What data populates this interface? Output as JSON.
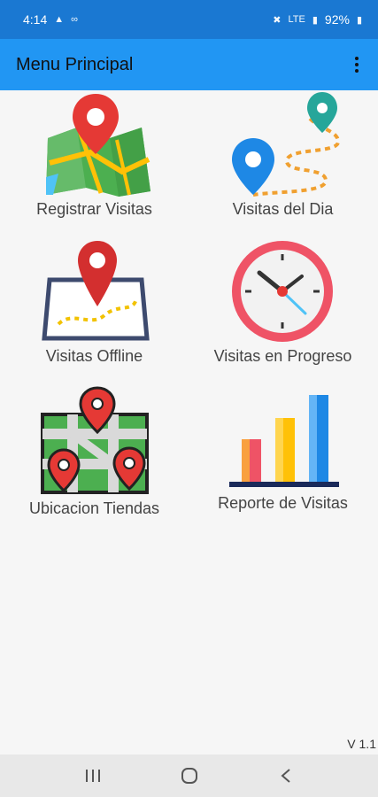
{
  "status_bar": {
    "time": "4:14",
    "battery": "92%",
    "signal_label": "LTE"
  },
  "app_bar": {
    "title": "Menu Principal",
    "overflow_icon": "more-vertical-icon"
  },
  "menu": [
    {
      "label": "Registrar Visitas",
      "icon": "map-pin-icon"
    },
    {
      "label": "Visitas del Dia",
      "icon": "route-icon"
    },
    {
      "label": "Visitas Offline",
      "icon": "offline-map-icon"
    },
    {
      "label": "Visitas en Progreso",
      "icon": "clock-icon"
    },
    {
      "label": "Ubicacion Tiendas",
      "icon": "store-map-icon"
    },
    {
      "label": "Reporte de Visitas",
      "icon": "bar-chart-icon"
    }
  ],
  "version": "V 1.1",
  "nav_bar": {
    "recent_icon": "recent-apps-icon",
    "home_icon": "home-icon",
    "back_icon": "back-icon"
  }
}
